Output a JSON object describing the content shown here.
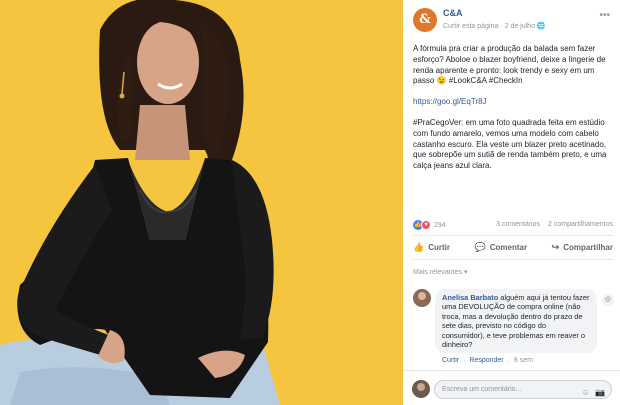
{
  "photo": {
    "background_color": "#f5c540",
    "alt_icon": "model-photo"
  },
  "post": {
    "page_name": "C&A",
    "avatar_letter": "&",
    "follow_label": "Curtir esta página",
    "separator": "·",
    "date": "2 de julho",
    "privacy_icon": "globe-icon",
    "more_icon": "more-options-icon",
    "paragraph1": "A fórmula pra criar a produção da balada sem fazer esforço? Aboloe o blazer boyfriend, deixe a lingerie de renda aparente e pronto: look trendy e sexy em um passo 😉 #LookC&A #CheckIn",
    "link": "https://goo.gl/EqTr8J",
    "paragraph3": "#PraCegoVer: em uma foto quadrada feita em estúdio com fundo amarelo, vemos uma modelo com cabelo castanho escuro. Ela veste um blazer preto acetinado, que sobrepõe um sutiã de renda também preto, e uma calça jeans azul clara."
  },
  "stats": {
    "reaction_count": "294",
    "comments": "3 comentários",
    "shares": "2 compartilhamentos"
  },
  "actions": {
    "like": "Curtir",
    "comment": "Comentar",
    "share": "Compartilhar"
  },
  "relevance": "Mais relevantes ▾",
  "comment": {
    "author": "Anelisa Barbato",
    "text": "alguém aqui já tentou fazer uma DEVOLUÇÃO de compra online (não troca, mas a devolução dentro do prazo de sete dias, previsto no código do consumidor), e teve problemas em reaver o dinheiro?",
    "like": "Curtir",
    "reply": "Responder",
    "separator": "·",
    "time": "8 sem",
    "badge": "@"
  },
  "composer": {
    "placeholder": "Escreva um comentário...",
    "emoji_icon": "☺",
    "camera_icon": "📷"
  },
  "colors": {
    "brand_link": "#385898",
    "muted": "#90949c",
    "like_blue": "#4080ff",
    "love_red": "#f25268"
  }
}
